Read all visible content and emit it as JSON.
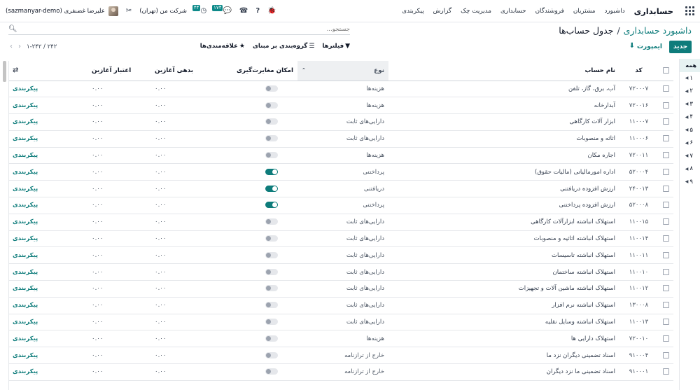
{
  "navbar": {
    "brand": "حسابداری",
    "menu": [
      "داشبورد",
      "مشتریان",
      "فروشندگان",
      "حسابداری",
      "مدیریت چک",
      "گزارش",
      "پیکربندی"
    ],
    "messages_count": "۱۷۴",
    "activity_count": "۴۴",
    "company": "شرکت من (تهران)",
    "user": "علیرضا غضنفری (sazmanyar-demo)"
  },
  "breadcrumb": {
    "parent": "داشبورد حسابداری",
    "separator": "/",
    "current": "جدول حساب‌ها"
  },
  "search": {
    "placeholder": "جستجو..."
  },
  "buttons": {
    "new": "جدید",
    "import": "ایمپورت"
  },
  "filters": {
    "filters": "فیلترها",
    "group_by": "گروه‌بندی بر مبنای",
    "favorites": "علاقه‌مندی‌ها"
  },
  "pager": {
    "range": "۱-۲۴۲ / ۲۴۲"
  },
  "side_panel": {
    "all": "همه",
    "items": [
      "۱",
      "۲",
      "۳",
      "۴",
      "۵",
      "۶",
      "۷",
      "۸",
      "۹"
    ]
  },
  "table": {
    "headers": {
      "code": "کد",
      "name": "نام حساب",
      "type": "نوع",
      "reconcile": "امکان مغایرت‌گیری",
      "opening_debit": "بدهی آغازین",
      "opening_credit": "اعتبار آغازین"
    },
    "setup_label": "پیکربندی",
    "rows": [
      {
        "code": "۷۲۰۰۰۷",
        "name": "آب، برق، گاز، تلفن",
        "type": "هزینه‌ها",
        "reconcile": false,
        "debit": "۰.۰۰",
        "credit": "۰.۰۰"
      },
      {
        "code": "۷۲۰۰۱۶",
        "name": "آبدارخانه",
        "type": "هزینه‌ها",
        "reconcile": false,
        "debit": "۰.۰۰",
        "credit": "۰.۰۰"
      },
      {
        "code": "۱۱۰۰۰۷",
        "name": "ابزار آلات کارگاهی",
        "type": "دارایی‌های ثابت",
        "reconcile": false,
        "debit": "۰.۰۰",
        "credit": "۰.۰۰"
      },
      {
        "code": "۱۱۰۰۰۶",
        "name": "اثاثه و منصوبات",
        "type": "دارایی‌های ثابت",
        "reconcile": false,
        "debit": "۰.۰۰",
        "credit": "۰.۰۰"
      },
      {
        "code": "۷۲۰۰۱۱",
        "name": "اجاره مکان",
        "type": "هزینه‌ها",
        "reconcile": false,
        "debit": "۰.۰۰",
        "credit": "۰.۰۰"
      },
      {
        "code": "۵۲۰۰۰۴",
        "name": "اداره امورمالیاتی (مالیات حقوق)",
        "type": "پرداختنی",
        "reconcile": true,
        "debit": "۰.۰۰",
        "credit": "۰.۰۰"
      },
      {
        "code": "۲۴۰۰۱۳",
        "name": "ارزش افزوده دریافتنی",
        "type": "دریافتنی",
        "reconcile": true,
        "debit": "۰.۰۰",
        "credit": "۰.۰۰"
      },
      {
        "code": "۵۲۰۰۰۸",
        "name": "ارزش افزوده پرداختنی",
        "type": "پرداختنی",
        "reconcile": true,
        "debit": "۰.۰۰",
        "credit": "۰.۰۰"
      },
      {
        "code": "۱۱۰۰۱۵",
        "name": "استهلاک انباشته ابزارآلات کارگاهی",
        "type": "دارایی‌های ثابت",
        "reconcile": false,
        "debit": "۰.۰۰",
        "credit": "۰.۰۰"
      },
      {
        "code": "۱۱۰۰۱۴",
        "name": "استهلاک انباشته اثاثیه و منصوبات",
        "type": "دارایی‌های ثابت",
        "reconcile": false,
        "debit": "۰.۰۰",
        "credit": "۰.۰۰"
      },
      {
        "code": "۱۱۰۰۱۱",
        "name": "استهلاک انباشته تاسیسات",
        "type": "دارایی‌های ثابت",
        "reconcile": false,
        "debit": "۰.۰۰",
        "credit": "۰.۰۰"
      },
      {
        "code": "۱۱۰۰۱۰",
        "name": "استهلاک انباشته ساختمان",
        "type": "دارایی‌های ثابت",
        "reconcile": false,
        "debit": "۰.۰۰",
        "credit": "۰.۰۰"
      },
      {
        "code": "۱۱۰۰۱۲",
        "name": "استهلاک انباشته ماشین آلات و تجهیزات",
        "type": "دارایی‌های ثابت",
        "reconcile": false,
        "debit": "۰.۰۰",
        "credit": "۰.۰۰"
      },
      {
        "code": "۱۳۰۰۰۸",
        "name": "استهلاک انباشته نرم افزار",
        "type": "دارایی‌های ثابت",
        "reconcile": false,
        "debit": "۰.۰۰",
        "credit": "۰.۰۰"
      },
      {
        "code": "۱۱۰۰۱۳",
        "name": "استهلاک انباشته وسایل نقلیه",
        "type": "دارایی‌های ثابت",
        "reconcile": false,
        "debit": "۰.۰۰",
        "credit": "۰.۰۰"
      },
      {
        "code": "۷۲۰۰۱۰",
        "name": "استهلاک دارایی ها",
        "type": "هزینه‌ها",
        "reconcile": false,
        "debit": "۰.۰۰",
        "credit": "۰.۰۰"
      },
      {
        "code": "۹۱۰۰۰۴",
        "name": "اسناد تضمینی دیگران نزد ما",
        "type": "خارج از ترازنامه",
        "reconcile": false,
        "debit": "۰.۰۰",
        "credit": "۰.۰۰"
      },
      {
        "code": "۹۱۰۰۰۱",
        "name": "اسناد تضمینی ما نزد دیگران",
        "type": "خارج از ترازنامه",
        "reconcile": false,
        "debit": "۰.۰۰",
        "credit": "۰.۰۰"
      }
    ]
  },
  "colors": {
    "accent": "#0e7c7b",
    "badge": "#0e8a8a",
    "type_header_bg": "#eef0f2"
  }
}
